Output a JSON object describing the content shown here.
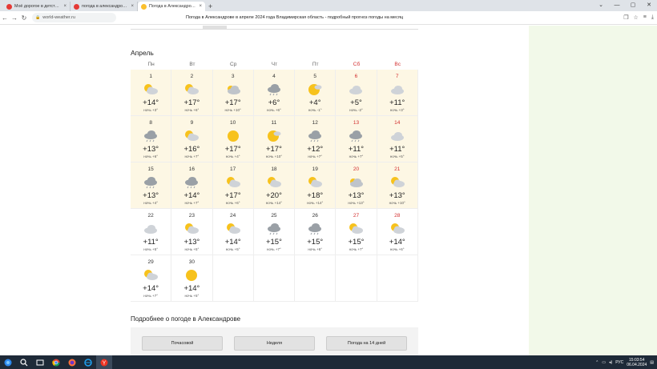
{
  "browser": {
    "tabs": [
      {
        "title": "Моё дорогое в детстве - С",
        "fav": "#e53935"
      },
      {
        "title": "погода в александрове в а",
        "fav": "#e53935"
      },
      {
        "title": "Погода в Александрове в",
        "fav": "#fbc02d",
        "active": true
      }
    ],
    "new_tab": "+",
    "controls": [
      "⌄",
      "—",
      "▢",
      "✕"
    ],
    "url": "world-weather.ru",
    "page_title": "Погода в Александрове в апреле 2024 года Владимирская область - подробный прогноз погоды на месяц"
  },
  "calendar": {
    "title": "Апрель",
    "weekdays": [
      "Пн",
      "Вт",
      "Ср",
      "Чт",
      "Пт",
      "Сб",
      "Вс"
    ],
    "weeks": [
      [
        {
          "d": "1",
          "icon": "partly-cloudy",
          "day": "+14°",
          "night": "ночь +3°"
        },
        {
          "d": "2",
          "icon": "partly-cloudy",
          "day": "+17°",
          "night": "ночь +6°"
        },
        {
          "d": "3",
          "icon": "cloudy-sun",
          "day": "+17°",
          "night": "ночь +10°"
        },
        {
          "d": "4",
          "icon": "cloudy-rain",
          "day": "+6°",
          "night": "ночь +6°"
        },
        {
          "d": "5",
          "icon": "sun-cloud",
          "day": "+4°",
          "night": "ночь -1°"
        },
        {
          "d": "6",
          "icon": "cloudy-light",
          "day": "+5°",
          "night": "ночь -2°"
        },
        {
          "d": "7",
          "icon": "cloudy-light",
          "day": "+11°",
          "night": "ночь +3°"
        }
      ],
      [
        {
          "d": "8",
          "icon": "cloudy-rain",
          "day": "+13°",
          "night": "ночь +6°"
        },
        {
          "d": "9",
          "icon": "partly-cloudy",
          "day": "+16°",
          "night": "ночь +7°"
        },
        {
          "d": "10",
          "icon": "sun",
          "day": "+17°",
          "night": "ночь +4°"
        },
        {
          "d": "11",
          "icon": "sun-cloud",
          "day": "+17°",
          "night": "ночь +10°"
        },
        {
          "d": "12",
          "icon": "cloudy-rain",
          "day": "+12°",
          "night": "ночь +7°"
        },
        {
          "d": "13",
          "icon": "cloudy-rain",
          "day": "+11°",
          "night": "ночь +7°"
        },
        {
          "d": "14",
          "icon": "cloudy-light",
          "day": "+11°",
          "night": "ночь +5°"
        }
      ],
      [
        {
          "d": "15",
          "icon": "cloudy-rain",
          "day": "+13°",
          "night": "ночь +4°"
        },
        {
          "d": "16",
          "icon": "cloudy-rain",
          "day": "+14°",
          "night": "ночь +7°"
        },
        {
          "d": "17",
          "icon": "partly-cloudy",
          "day": "+17°",
          "night": "ночь +6°"
        },
        {
          "d": "18",
          "icon": "partly-cloudy",
          "day": "+20°",
          "night": "ночь +14°"
        },
        {
          "d": "19",
          "icon": "partly-cloudy",
          "day": "+18°",
          "night": "ночь +14°"
        },
        {
          "d": "20",
          "icon": "cloudy-sun",
          "day": "+13°",
          "night": "ночь +13°"
        },
        {
          "d": "21",
          "icon": "partly-cloudy",
          "day": "+13°",
          "night": "ночь +10°"
        }
      ],
      [
        {
          "d": "22",
          "icon": "cloudy-light",
          "day": "+11°",
          "night": "ночь +5°"
        },
        {
          "d": "23",
          "icon": "partly-cloudy",
          "day": "+13°",
          "night": "ночь +5°"
        },
        {
          "d": "24",
          "icon": "partly-cloudy",
          "day": "+14°",
          "night": "ночь +5°"
        },
        {
          "d": "25",
          "icon": "cloudy-rain",
          "day": "+15°",
          "night": "ночь +7°"
        },
        {
          "d": "26",
          "icon": "cloudy-rain",
          "day": "+15°",
          "night": "ночь +6°"
        },
        {
          "d": "27",
          "icon": "partly-cloudy",
          "day": "+15°",
          "night": "ночь +7°"
        },
        {
          "d": "28",
          "icon": "partly-cloudy",
          "day": "+14°",
          "night": "ночь +6°"
        }
      ],
      [
        {
          "d": "29",
          "icon": "partly-cloudy",
          "day": "+14°",
          "night": "ночь +7°"
        },
        {
          "d": "30",
          "icon": "sun",
          "day": "+14°",
          "night": "ночь +5°"
        },
        null,
        null,
        null,
        null,
        null
      ]
    ]
  },
  "more": {
    "title": "Подробнее о погоде в Александрове",
    "buttons": [
      "Почасовой",
      "Неделя",
      "Погода на 14 дней"
    ]
  },
  "taskbar": {
    "lang": "РУС",
    "time": "15:03:54",
    "date": "06.04.2024"
  },
  "colors": {
    "sun": "#f7c21c",
    "cloud": "#cfd3d8",
    "dark_cloud": "#9aa0a6",
    "weekend": "#d32f2f",
    "green_bg": "#f2f9e9"
  }
}
